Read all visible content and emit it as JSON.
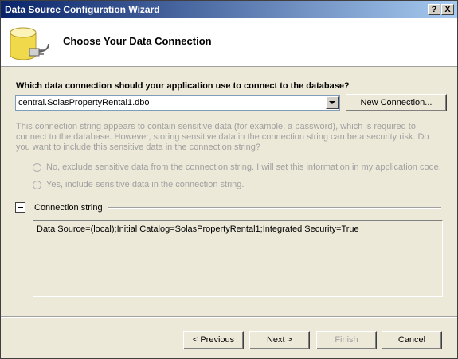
{
  "window": {
    "title": "Data Source Configuration Wizard",
    "help_label": "?",
    "close_label": "X"
  },
  "header": {
    "title": "Choose Your Data Connection",
    "icon": "database-plug-icon"
  },
  "connection": {
    "question": "Which data connection should your application use to connect to the database?",
    "selected": "central.SolasPropertyRental1.dbo",
    "new_connection_label": "New Connection..."
  },
  "sensitive": {
    "message": "This connection string appears to contain sensitive data (for example, a password), which is required to connect to the database. However, storing sensitive data in the connection string can be a security risk. Do you want to include this sensitive data in the connection string?",
    "option_no": "No, exclude sensitive data from the connection string. I will set this information in my application code.",
    "option_yes": "Yes, include sensitive data in the connection string."
  },
  "connection_string": {
    "label": "Connection string",
    "value": "Data Source=(local);Initial Catalog=SolasPropertyRental1;Integrated Security=True"
  },
  "buttons": {
    "previous": "< Previous",
    "next": "Next >",
    "finish": "Finish",
    "cancel": "Cancel"
  }
}
